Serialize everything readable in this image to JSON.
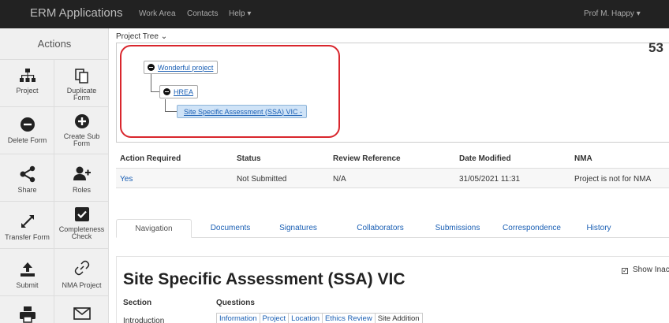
{
  "topbar": {
    "brand": "ERM Applications",
    "nav": [
      "Work Area",
      "Contacts",
      "Help ▾"
    ],
    "user": "Prof M. Happy ▾"
  },
  "sidebar": {
    "title": "Actions",
    "actions": [
      {
        "label": "Project",
        "icon": "sitemap-icon"
      },
      {
        "label": "Duplicate Form",
        "icon": "copy-icon"
      },
      {
        "label": "Delete Form",
        "icon": "minus-circle-icon"
      },
      {
        "label": "Create Sub Form",
        "icon": "plus-circle-icon"
      },
      {
        "label": "Share",
        "icon": "share-icon"
      },
      {
        "label": "Roles",
        "icon": "user-plus-icon"
      },
      {
        "label": "Transfer Form",
        "icon": "transfer-icon"
      },
      {
        "label": "Completeness Check",
        "icon": "checkbox-icon"
      },
      {
        "label": "Submit",
        "icon": "upload-icon"
      },
      {
        "label": "NMA Project",
        "icon": "link-icon"
      },
      {
        "label": "",
        "icon": "print-icon"
      },
      {
        "label": "",
        "icon": "envelope-icon"
      }
    ]
  },
  "tree": {
    "label": "Project Tree ⌄",
    "number": "53",
    "nodes": [
      "Wonderful project",
      "HREA",
      "Site Specific Assessment (SSA) VIC -"
    ]
  },
  "summary": {
    "headers": [
      "Action Required",
      "Status",
      "Review Reference",
      "Date Modified",
      "NMA"
    ],
    "values": [
      "Yes",
      "Not Submitted",
      "N/A",
      "31/05/2021 11:31",
      "Project is not for NMA"
    ]
  },
  "tabs": [
    "Navigation",
    "Documents",
    "Signatures",
    "Collaborators",
    "Submissions",
    "Correspondence",
    "History"
  ],
  "content": {
    "show_inactive": "Show Inactiv",
    "form_title": "Site Specific Assessment (SSA) VIC",
    "section_header": "Section",
    "questions_header": "Questions",
    "first_section": "Introduction",
    "question_tabs": [
      "Information",
      "Project",
      "Location",
      "Ethics Review",
      "Site Addition"
    ]
  }
}
